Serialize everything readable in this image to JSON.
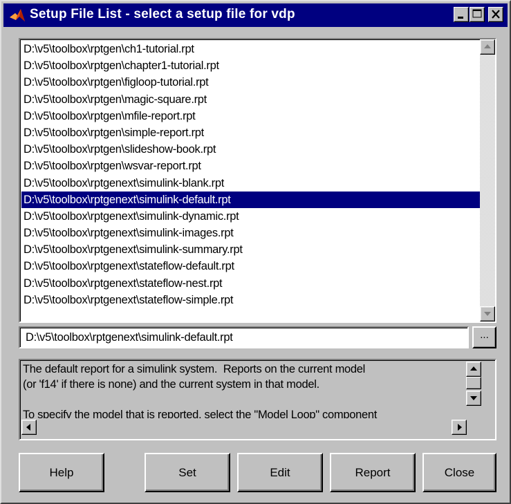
{
  "window": {
    "title": "Setup File List - select a setup file for vdp",
    "icon": "matlab-icon",
    "controls": [
      "minimize-icon",
      "maximize-icon",
      "close-icon"
    ]
  },
  "file_list": {
    "items": [
      "D:\\v5\\toolbox\\rptgen\\ch1-tutorial.rpt",
      "D:\\v5\\toolbox\\rptgen\\chapter1-tutorial.rpt",
      "D:\\v5\\toolbox\\rptgen\\figloop-tutorial.rpt",
      "D:\\v5\\toolbox\\rptgen\\magic-square.rpt",
      "D:\\v5\\toolbox\\rptgen\\mfile-report.rpt",
      "D:\\v5\\toolbox\\rptgen\\simple-report.rpt",
      "D:\\v5\\toolbox\\rptgen\\slideshow-book.rpt",
      "D:\\v5\\toolbox\\rptgen\\wsvar-report.rpt",
      "D:\\v5\\toolbox\\rptgenext\\simulink-blank.rpt",
      "D:\\v5\\toolbox\\rptgenext\\simulink-default.rpt",
      "D:\\v5\\toolbox\\rptgenext\\simulink-dynamic.rpt",
      "D:\\v5\\toolbox\\rptgenext\\simulink-images.rpt",
      "D:\\v5\\toolbox\\rptgenext\\simulink-summary.rpt",
      "D:\\v5\\toolbox\\rptgenext\\stateflow-default.rpt",
      "D:\\v5\\toolbox\\rptgenext\\stateflow-nest.rpt",
      "D:\\v5\\toolbox\\rptgenext\\stateflow-simple.rpt"
    ],
    "selected_index": 9
  },
  "path_field": {
    "value": "D:\\v5\\toolbox\\rptgenext\\simulink-default.rpt",
    "browse_label": "..."
  },
  "description": {
    "text": "The default report for a simulink system.  Reports on the current model\n(or 'f14' if there is none) and the current system in that model.\n\nTo specify the model that is reported, select the \"Model Loop\" component"
  },
  "buttons": {
    "help": "Help",
    "set": "Set",
    "edit": "Edit",
    "report": "Report",
    "close": "Close"
  }
}
